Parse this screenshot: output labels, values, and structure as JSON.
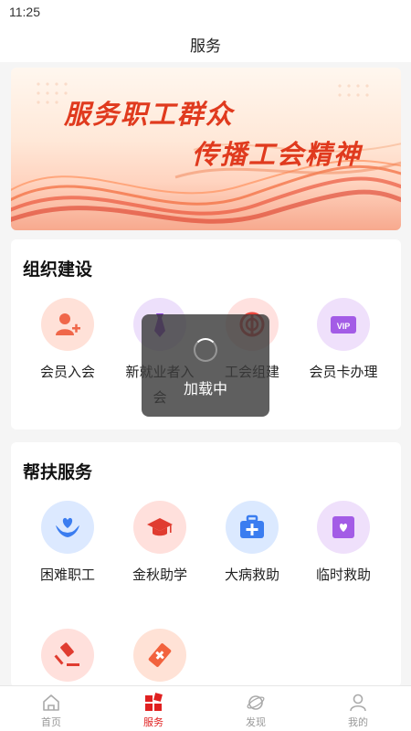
{
  "status": {
    "time": "11:25"
  },
  "header": {
    "title": "服务"
  },
  "banner": {
    "line1": "服务职工群众",
    "line2": "传播工会精神"
  },
  "org_section": {
    "title": "组织建设",
    "items": [
      {
        "label": "会员入会",
        "icon": "member-join-icon"
      },
      {
        "label": "新就业者入会",
        "icon": "tie-icon"
      },
      {
        "label": "工会组建",
        "icon": "union-emblem-icon"
      },
      {
        "label": "会员卡办理",
        "icon": "vip-card-icon"
      }
    ]
  },
  "help_section": {
    "title": "帮扶服务",
    "items": [
      {
        "label": "困难职工",
        "icon": "heart-hands-icon"
      },
      {
        "label": "金秋助学",
        "icon": "graduation-cap-icon"
      },
      {
        "label": "大病救助",
        "icon": "medical-kit-icon"
      },
      {
        "label": "临时救助",
        "icon": "heart-box-icon"
      },
      {
        "label": "",
        "icon": "gavel-icon"
      },
      {
        "label": "",
        "icon": "bandage-icon"
      }
    ]
  },
  "toast": {
    "text": "加载中"
  },
  "tabbar": {
    "tabs": [
      {
        "label": "首页",
        "icon": "home-icon"
      },
      {
        "label": "服务",
        "icon": "service-grid-icon"
      },
      {
        "label": "发现",
        "icon": "planet-icon"
      },
      {
        "label": "我的",
        "icon": "user-icon"
      }
    ]
  },
  "colors": {
    "accent": "#e02020",
    "inactive": "#999999"
  }
}
